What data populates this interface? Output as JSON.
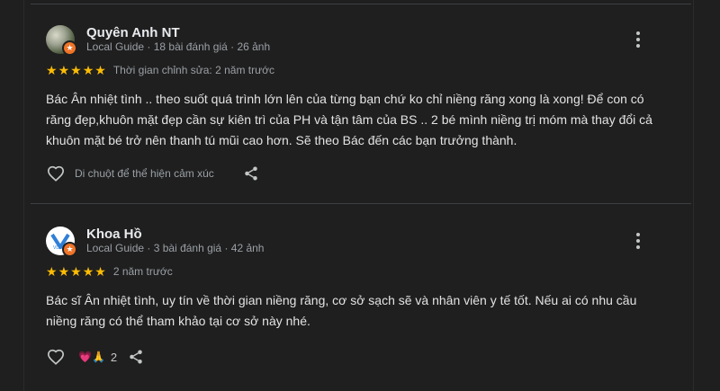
{
  "reviews": [
    {
      "author": "Quyên Anh NT",
      "meta": "Local Guide · 18 bài đánh giá · 26 ảnh",
      "rating": 5,
      "stars": "★★★★★",
      "date": "Thời gian chỉnh sửa: 2 năm trước",
      "text": "Bác Ân nhiệt tình .. theo suốt quá trình lớn lên của từng bạn chứ ko chỉ niềng răng xong là xong! Để con có răng đẹp,khuôn mặt đẹp cần sự kiên trì của PH và tận tâm của BS .. 2 bé mình niềng trị móm mà thay đổi cả khuôn mặt bé trở nên thanh tú mũi cao hơn. Sẽ theo Bác đến các bạn trưởng thành.",
      "reaction_hint": "Di chuột để thể hiện cảm xúc"
    },
    {
      "author": "Khoa Hồ",
      "meta": "Local Guide · 3 bài đánh giá · 42 ảnh",
      "rating": 5,
      "stars": "★★★★★",
      "date": "2 năm trước",
      "text": "Bác sĩ Ân nhiệt tình, uy tín về thời gian niềng răng, cơ sở sạch sẽ và nhân viên y tế tốt. Nếu ai có nhu cầu niềng răng có thể tham khảo tại cơ sở này nhé.",
      "reactions_emoji": "💗🙏",
      "reactions_count": "2"
    }
  ],
  "colors": {
    "background": "#1f1f1f",
    "star": "#fbbc04",
    "guide_badge": "#f07428",
    "text_secondary": "#9aa0a6"
  },
  "icons": [
    "local-guide-badge-icon",
    "more-options-icon",
    "heart-icon",
    "share-icon",
    "star-icon"
  ]
}
